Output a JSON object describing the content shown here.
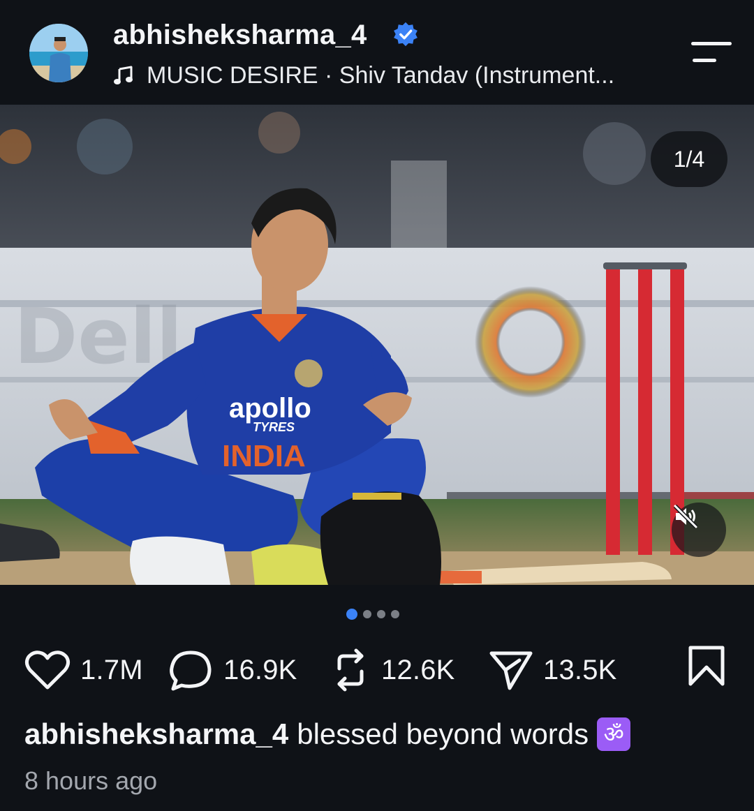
{
  "header": {
    "username": "abhisheksharma_4",
    "verified": true,
    "music_text": "MUSIC DESIRE · Shiv Tandav (Instrument..."
  },
  "media": {
    "counter": "1/4",
    "muted": true,
    "page_dots": {
      "count": 4,
      "active": 1
    }
  },
  "actions": {
    "likes": "1.7M",
    "comments": "16.9K",
    "reposts": "12.6K",
    "shares": "13.5K"
  },
  "caption": {
    "username": "abhisheksharma_4",
    "text": "blessed beyond words",
    "emoji": "ॐ"
  },
  "timestamp": "8 hours ago",
  "colors": {
    "background": "#0f1217",
    "verified": "#3b82f6",
    "active_dot": "#3b82f6",
    "om_badge": "#9b5cf6"
  }
}
